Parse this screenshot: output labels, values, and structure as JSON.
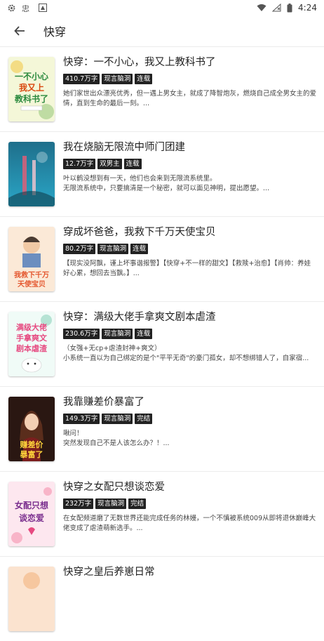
{
  "status_bar": {
    "time": "4:24"
  },
  "appbar": {
    "title": "快穿"
  },
  "books": [
    {
      "title": "快穿：一不小心，我又上教科书了",
      "tags": [
        "410.7万字",
        "现言脑洞",
        "连载"
      ],
      "desc": "她们家世出众漂亮优秀，但一遇上男女主，就成了降智炮灰，燃烧自己成全男女主的爱情，直到生命的最后一刻。...",
      "cover_text": "一不小心\n我又上\n教科书了"
    },
    {
      "title": "我在烧脑无限流中师门团建",
      "tags": [
        "12.7万字",
        "双男主",
        "连载"
      ],
      "desc": "叶以鹤没想到有一天，他们也会来到无限流系统里。\n        无限流系统中，只要搞清是一个秘密，就可以面见神明，提出愿望。...",
      "cover_text": ""
    },
    {
      "title": "穿成坏爸爸，我救下千万天使宝贝",
      "tags": [
        "80.2万字",
        "现言脑洞",
        "连载"
      ],
      "desc": "【现实没阿飘，谨上坏事谐报警】【快穿+不一样的甜文】【救赎+治愈】【肖帅：养娃好心累，想回去当飘。】...",
      "cover_text": "我救下千万\n天使宝贝"
    },
    {
      "title": "快穿：满级大佬手拿爽文剧本虐渣",
      "tags": [
        "230.6万字",
        "现言脑洞",
        "连载"
      ],
      "desc": "（女强+无cp+虐渣封神+爽文）\n        小系统一直以为自己绑定的是个\"平平无奇\"的豪门孤女，却不想绑错人了，自家宿...",
      "cover_text": "满级大佬\n手拿爽文\n剧本虐渣"
    },
    {
      "title": "我靠赚差价暴富了",
      "tags": [
        "149.3万字",
        "现言脑洞",
        "完结"
      ],
      "desc": "啾问！\n        突然发现自己不是人该怎么办？！...",
      "cover_text": "赚差价\n暴富了"
    },
    {
      "title": "快穿之女配只想谈恋爱",
      "tags": [
        "232万字",
        "现言脑洞",
        "完结"
      ],
      "desc": "在女配频道磨了无数世界还能完成任务的林嫚，一个不慎被系统009从即将退休巅峰大佬变成了虐渣萌新选手。...",
      "cover_text": "女配只想\n谈恋爱"
    },
    {
      "title": "快穿之皇后养崽日常",
      "tags": [],
      "desc": "",
      "cover_text": ""
    }
  ]
}
